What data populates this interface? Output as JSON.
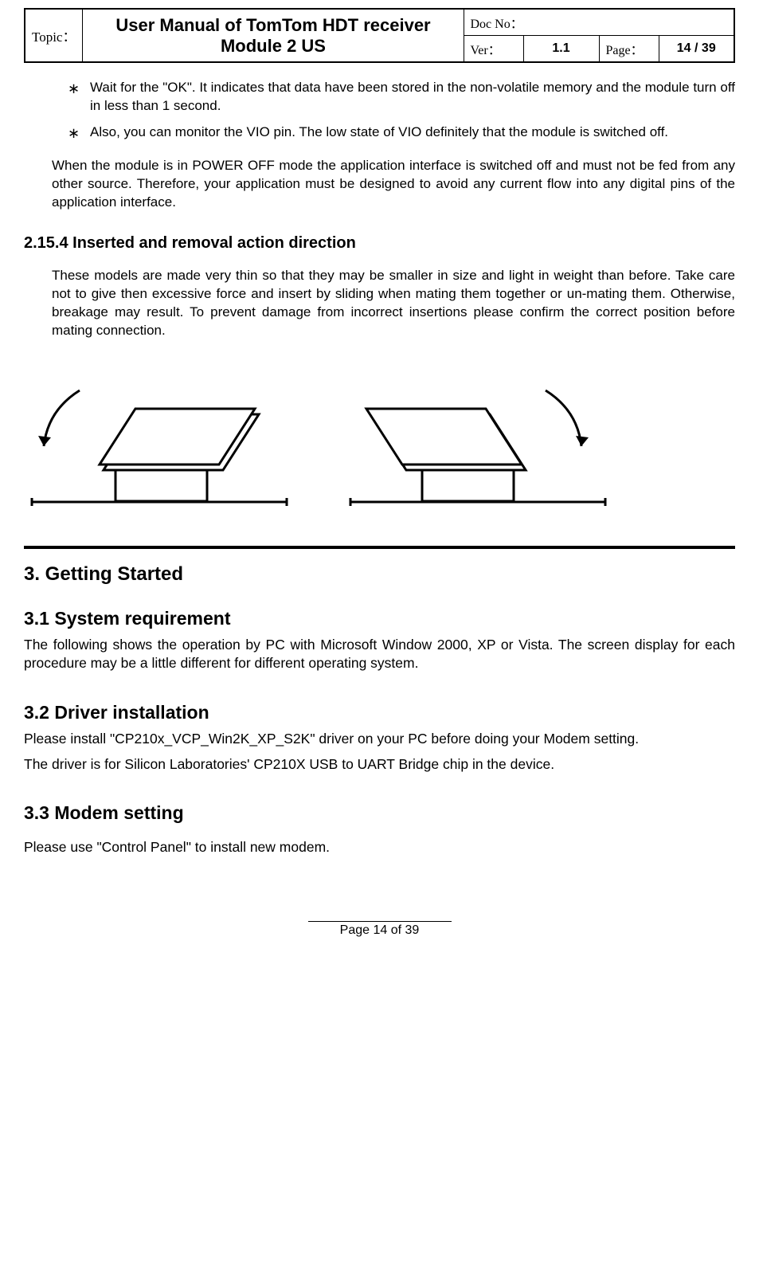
{
  "header": {
    "topic_label": "Topic：",
    "topic_value": "User Manual of TomTom HDT receiver  Module 2 US",
    "doc_no_label": "Doc No：",
    "doc_no_value": "",
    "ver_label": "Ver：",
    "ver_value": "1.1",
    "page_label": "Page：",
    "page_value": "14 / 39"
  },
  "bullets": [
    "Wait for the \"OK\". It indicates that data have been stored in the non-volatile memory and the module turn off in less than 1 second.",
    "Also, you can monitor the VIO pin. The low state of VIO definitely that the module is switched off."
  ],
  "power_off_para": "When the module is in POWER OFF mode the application interface is switched off and must not be fed from any other source. Therefore, your application must be designed to avoid any current flow into any digital pins of the application interface.",
  "section_2154_title": "2.15.4  Inserted and removal action direction",
  "section_2154_body": "These models are made very thin so that they may be smaller in size and light in weight than before. Take care not to give then excessive force and insert by sliding when mating them together or un-mating them. Otherwise, breakage may result. To prevent damage from incorrect insertions please confirm the correct position before mating connection.",
  "section_3_title": "3.     Getting Started",
  "section_31_title": "3.1  System requirement",
  "section_31_body": "The following shows the operation by PC with Microsoft Window 2000, XP or Vista. The screen display for each procedure may be a little different for different operating system.",
  "section_32_title": "3.2  Driver installation",
  "section_32_body1": "Please install \"CP210x_VCP_Win2K_XP_S2K\" driver on your PC before doing your Modem setting.",
  "section_32_body2": "The driver is for Silicon Laboratories' CP210X USB to UART Bridge chip in the device.",
  "section_33_title": "3.3  Modem setting",
  "section_33_body": "Please use \"Control Panel\" to install new modem.",
  "footer": "Page 14 of 39"
}
